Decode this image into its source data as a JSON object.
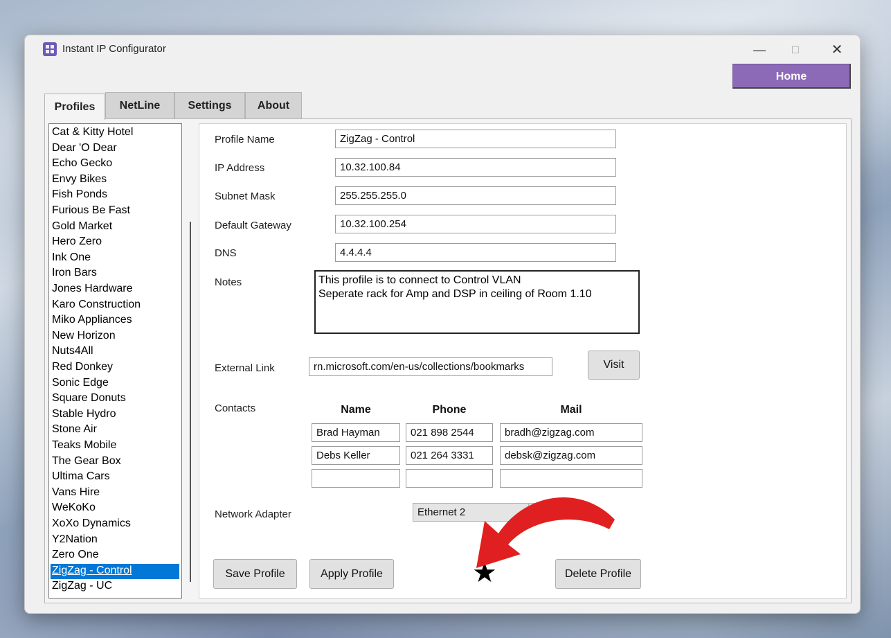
{
  "window": {
    "title": "Instant IP Configurator"
  },
  "header": {
    "home_label": "Home"
  },
  "tabs": [
    {
      "label": "Profiles"
    },
    {
      "label": "NetLine"
    },
    {
      "label": "Settings"
    },
    {
      "label": "About"
    }
  ],
  "profiles": {
    "items": [
      "Cat & Kitty Hotel",
      "Dear 'O Dear",
      "Echo Gecko",
      "Envy Bikes",
      "Fish Ponds",
      "Furious Be Fast",
      "Gold Market",
      "Hero Zero",
      "Ink One",
      "Iron Bars",
      "Jones Hardware",
      "Karo Construction",
      "Miko Appliances",
      "New Horizon",
      "Nuts4All",
      "Red Donkey",
      "Sonic Edge",
      "Square Donuts",
      "Stable Hydro",
      "Stone Air",
      "Teaks Mobile",
      "The Gear Box",
      "Ultima Cars",
      "Vans Hire",
      "WeKoKo",
      "XoXo Dynamics",
      "Y2Nation",
      "Zero One",
      "ZigZag - Control",
      "ZigZag - UC"
    ],
    "selected": "ZigZag - Control"
  },
  "form": {
    "profile_name_label": "Profile Name",
    "profile_name": "ZigZag - Control",
    "ip_label": "IP Address",
    "ip": "10.32.100.84",
    "subnet_label": "Subnet Mask",
    "subnet": "255.255.255.0",
    "gateway_label": "Default Gateway",
    "gateway": "10.32.100.254",
    "dns_label": "DNS",
    "dns": "4.4.4.4",
    "notes_label": "Notes",
    "notes_line1": "This profile is to connect to Control VLAN",
    "notes_line2": "Seperate rack for Amp and DSP in ceiling of Room 1.10",
    "link_label": "External Link",
    "link": "rn.microsoft.com/en-us/collections/bookmarks",
    "visit_label": "Visit",
    "contacts_label": "Contacts",
    "col_name": "Name",
    "col_phone": "Phone",
    "col_mail": "Mail",
    "contacts": [
      {
        "name": "Brad Hayman",
        "phone": "021 898 2544",
        "mail": "bradh@zigzag.com"
      },
      {
        "name": "Debs Keller",
        "phone": "021 264 3331",
        "mail": "debsk@zigzag.com"
      },
      {
        "name": "",
        "phone": "",
        "mail": ""
      }
    ],
    "adapter_label": "Network Adapter",
    "adapter": "Ethernet 2"
  },
  "buttons": {
    "save": "Save Profile",
    "apply": "Apply Profile",
    "delete": "Delete Profile"
  },
  "annotations": {
    "star": "★",
    "arrow_color": "#e02020"
  }
}
